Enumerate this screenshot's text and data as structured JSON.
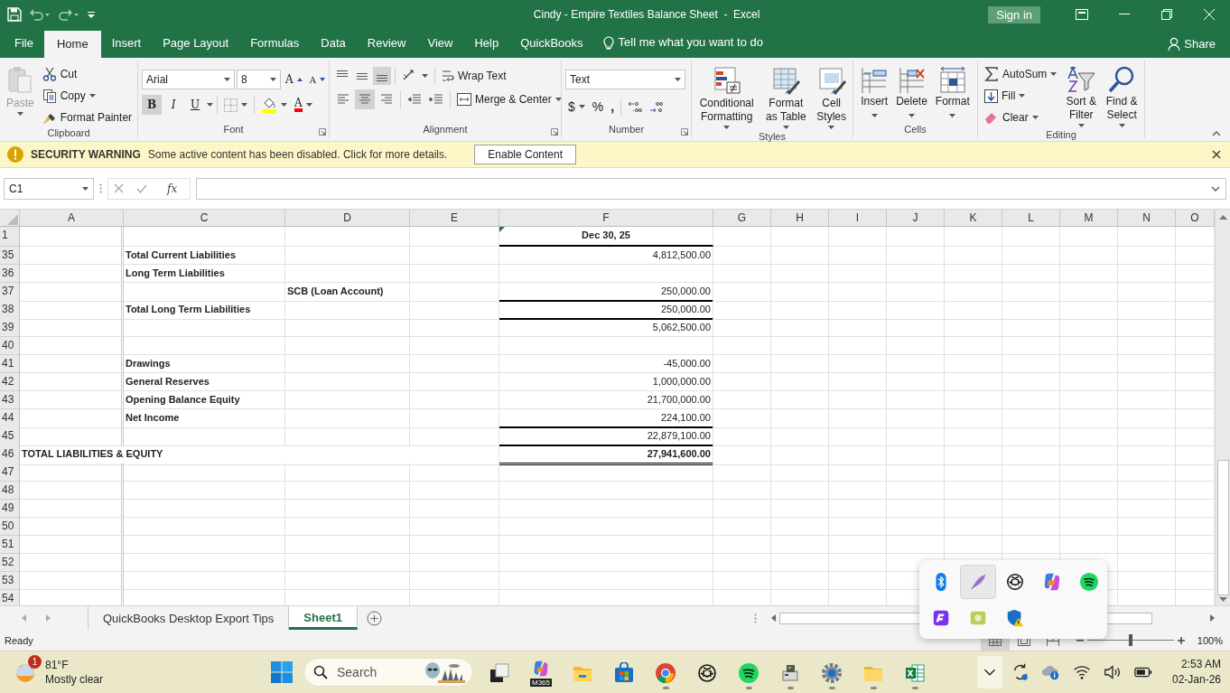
{
  "title_bar": {
    "title": "Cindy - Empire Textiles Balance Sheet  -  Excel",
    "sign_in": "Sign in"
  },
  "menu_tabs": [
    {
      "label": "File",
      "selected": false
    },
    {
      "label": "Home",
      "selected": true
    },
    {
      "label": "Insert",
      "selected": false
    },
    {
      "label": "Page Layout",
      "selected": false
    },
    {
      "label": "Formulas",
      "selected": false
    },
    {
      "label": "Data",
      "selected": false
    },
    {
      "label": "Review",
      "selected": false
    },
    {
      "label": "View",
      "selected": false
    },
    {
      "label": "Help",
      "selected": false
    },
    {
      "label": "QuickBooks",
      "selected": false
    }
  ],
  "tell_me": "Tell me what you want to do",
  "share": "Share",
  "ribbon": [
    {
      "kind": "clipboard",
      "label": "Clipboard",
      "paste": {
        "label": "Paste",
        "disabled": true
      },
      "cut": "Cut",
      "copy": "Copy",
      "painter": "Format Painter"
    },
    {
      "kind": "font",
      "label": "Font",
      "font_name": "Arial",
      "font_size": "8",
      "grow": "A",
      "shrink": "A",
      "font_color": "A",
      "styles": [
        {
          "label": "B",
          "on": true
        },
        {
          "label": "I",
          "on": false
        },
        {
          "label": "U",
          "on": false
        }
      ]
    },
    {
      "kind": "alignment",
      "label": "Alignment",
      "vertical": [
        {
          "selected": false
        },
        {
          "selected": false
        },
        {
          "selected": true
        }
      ],
      "horizontal": [
        {
          "selected": false
        },
        {
          "selected": true
        },
        {
          "selected": false
        }
      ],
      "wrap": "Wrap Text",
      "merge": "Merge & Center"
    },
    {
      "kind": "number",
      "label": "Number",
      "format": "Text",
      "currency": "$",
      "percent": "%",
      "comma": ","
    },
    {
      "kind": "styles",
      "label": "Styles",
      "buttons": [
        {
          "kind": "conditional",
          "label": "Conditional Formatting"
        },
        {
          "kind": "table",
          "label": "Format as Table"
        },
        {
          "kind": "cell_styles",
          "label": "Cell Styles"
        }
      ]
    },
    {
      "kind": "cells",
      "label": "Cells",
      "buttons": [
        {
          "kind": "insert",
          "label": "Insert"
        },
        {
          "kind": "delete",
          "label": "Delete"
        },
        {
          "kind": "format",
          "label": "Format"
        }
      ]
    },
    {
      "kind": "editing",
      "label": "Editing",
      "autosum": "AutoSum",
      "fill": "Fill",
      "clear": "Clear",
      "sort": "Sort & Filter",
      "find": "Find & Select"
    }
  ],
  "security_bar": {
    "title": "SECURITY WARNING",
    "message": "Some active content has been disabled. Click for more details.",
    "button": "Enable Content"
  },
  "formula_bar": {
    "name_box": "C1",
    "fx": "fx"
  },
  "sheet": {
    "columns": [
      "A",
      "C",
      "D",
      "E",
      "F",
      "G",
      "H",
      "I",
      "J",
      "K",
      "L",
      "M",
      "N",
      "O"
    ],
    "rows": [
      {
        "number": "1",
        "cells": [
          "",
          "",
          "",
          "",
          {
            "text": "Dec 30, 25",
            "bold": true,
            "bottom_rule": true,
            "error_flag": true
          }
        ]
      },
      {
        "number": "35",
        "cells": [
          "",
          {
            "text": "Total Current Liabilities",
            "bold": true
          },
          "",
          "",
          {
            "text": "4,812,500.00"
          }
        ]
      },
      {
        "number": "36",
        "cells": [
          "",
          {
            "text": "Long Term Liabilities",
            "bold": true
          }
        ]
      },
      {
        "number": "37",
        "cells": [
          "",
          "",
          {
            "text": "SCB (Loan Account)",
            "bold": true
          },
          "",
          {
            "text": "250,000.00",
            "bottom_rule": true
          }
        ]
      },
      {
        "number": "38",
        "cells": [
          "",
          {
            "text": "Total Long Term Liabilities",
            "bold": true
          },
          "",
          "",
          {
            "text": "250,000.00",
            "bottom_rule": true
          }
        ]
      },
      {
        "number": "39",
        "cells": [
          "",
          "",
          "",
          "",
          {
            "text": "5,062,500.00"
          }
        ]
      },
      {
        "number": "40",
        "cells": []
      },
      {
        "number": "41",
        "cells": [
          "",
          {
            "text": "Drawings",
            "bold": true
          },
          "",
          "",
          {
            "text": "-45,000.00"
          }
        ]
      },
      {
        "number": "42",
        "cells": [
          "",
          {
            "text": "General Reserves",
            "bold": true
          },
          "",
          "",
          {
            "text": "1,000,000.00"
          }
        ]
      },
      {
        "number": "43",
        "cells": [
          "",
          {
            "text": "Opening Balance Equity",
            "bold": true
          },
          "",
          "",
          {
            "text": "21,700,000.00"
          }
        ]
      },
      {
        "number": "44",
        "cells": [
          "",
          {
            "text": "Net Income",
            "bold": true
          },
          "",
          "",
          {
            "text": "224,100.00",
            "bottom_rule": true
          }
        ]
      },
      {
        "number": "45",
        "cells": [
          "",
          "",
          "",
          "",
          {
            "text": "22,879,100.00",
            "bottom_rule": true
          }
        ]
      },
      {
        "number": "46",
        "cells": [
          {
            "text": "TOTAL LIABILITIES & EQUITY",
            "bold": true
          },
          "",
          "",
          "",
          {
            "text": "27,941,600.00",
            "bold": true,
            "double_rule": true
          }
        ]
      },
      {
        "number": "47",
        "cells": []
      },
      {
        "number": "48",
        "cells": []
      },
      {
        "number": "49",
        "cells": []
      },
      {
        "number": "50",
        "cells": []
      },
      {
        "number": "51",
        "cells": []
      },
      {
        "number": "52",
        "cells": []
      },
      {
        "number": "53",
        "cells": []
      },
      {
        "number": "54",
        "cells": []
      }
    ]
  },
  "sheet_tabs": [
    {
      "label": "QuickBooks Desktop Export Tips",
      "selected": false
    },
    {
      "label": "Sheet1",
      "selected": true
    }
  ],
  "status_bar": {
    "status": "Ready",
    "views": [
      {
        "kind": "normal",
        "selected": true
      },
      {
        "kind": "page_layout",
        "selected": false
      },
      {
        "kind": "page_break",
        "selected": false
      }
    ],
    "zoom": {
      "label": "100%",
      "level": 0.5
    }
  },
  "taskbar": {
    "weather": {
      "temperature": "81°F",
      "condition": "Mostly clear",
      "badge": "1"
    },
    "search": "Search",
    "apps": [
      {
        "kind": "task_view",
        "running": false
      },
      {
        "kind": "m365",
        "badge": "M365",
        "running": false
      },
      {
        "kind": "explorer",
        "running": false
      },
      {
        "kind": "store",
        "running": false
      },
      {
        "kind": "chrome",
        "running": true
      },
      {
        "kind": "chatgpt",
        "running": false
      },
      {
        "kind": "spotify",
        "running": true
      },
      {
        "kind": "device",
        "running": true
      },
      {
        "kind": "settings",
        "running": true
      },
      {
        "kind": "folder",
        "running": true
      },
      {
        "kind": "excel",
        "running": true
      }
    ],
    "tray": [
      {
        "kind": "overflow",
        "selected": true
      },
      {
        "kind": "sync"
      },
      {
        "kind": "cloud"
      },
      {
        "kind": "wifi"
      },
      {
        "kind": "volume"
      },
      {
        "kind": "battery"
      }
    ],
    "time": "2:53 AM",
    "date": "02-Jan-26"
  },
  "tray_overflow": [
    {
      "kind": "bluetooth",
      "selected": false
    },
    {
      "kind": "feather",
      "selected": true
    },
    {
      "kind": "chatgpt",
      "selected": false
    },
    {
      "kind": "m365",
      "selected": false
    },
    {
      "kind": "spotify",
      "selected": false
    },
    {
      "kind": "purple_app",
      "selected": false
    },
    {
      "kind": "green_app",
      "selected": false
    },
    {
      "kind": "shield",
      "selected": false
    }
  ]
}
